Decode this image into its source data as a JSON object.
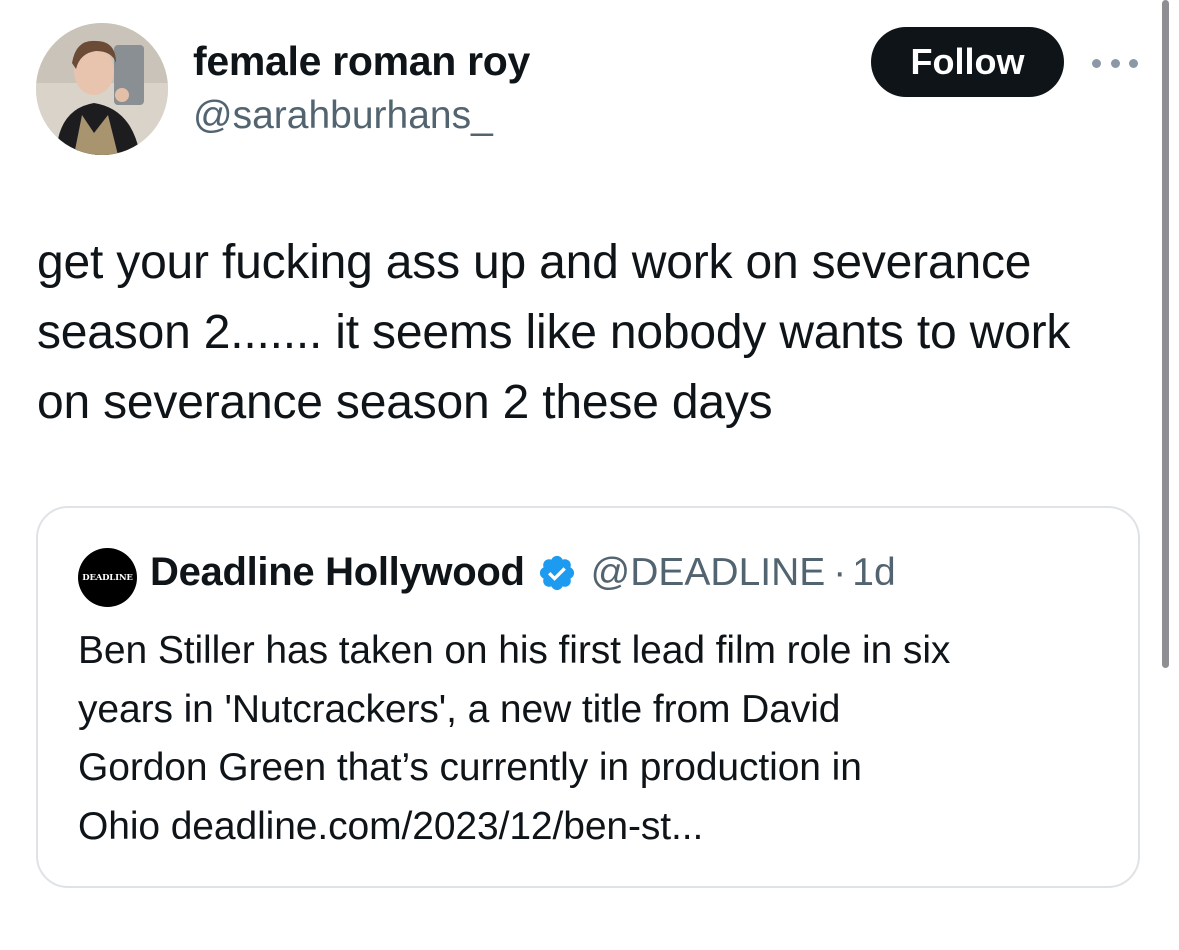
{
  "tweet": {
    "author": {
      "display_name": "female roman roy",
      "handle": "@sarahburhans_"
    },
    "follow_label": "Follow",
    "more_icon": "more-horizontal-icon",
    "text_lines": [
      "get your fucking ass up and work on severance",
      "season 2....... it seems like nobody wants to work",
      "on severance season 2 these days"
    ]
  },
  "quote": {
    "avatar_text": "DEADLINE",
    "display_name": "Deadline Hollywood",
    "verified_icon": "verified-badge-icon",
    "verified_color": "#1d9bf0",
    "handle": "@DEADLINE",
    "separator": "·",
    "time": "1d",
    "text_lines": [
      "Ben Stiller has taken on his first lead film role in six",
      "years in 'Nutcrackers', a new title from David",
      "Gordon Green that’s currently in production in",
      "Ohio deadline.com/2023/12/ben-st..."
    ]
  },
  "colors": {
    "primary_text": "#0f1419",
    "secondary_text": "#536471",
    "follow_button_bg": "#0f1419",
    "card_border": "#dfe3e6"
  }
}
